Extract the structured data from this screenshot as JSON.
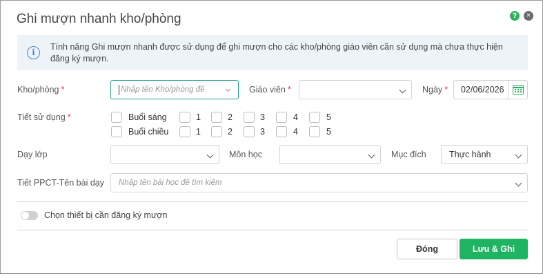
{
  "dialog": {
    "title": "Ghi mượn nhanh kho/phòng",
    "help_icon": "?",
    "close_icon": "×"
  },
  "info": {
    "icon": "i",
    "text": "Tính năng Ghi mượn nhanh được sử dụng để ghi mượn cho các kho/phòng giáo viên cần sử dụng mà chưa thực hiện đăng ký mượn."
  },
  "form": {
    "room": {
      "label": "Kho/phòng",
      "required": "*",
      "placeholder": "Nhập tên Kho/phòng để"
    },
    "teacher": {
      "label": "Giáo viên",
      "required": "*",
      "value": ""
    },
    "date": {
      "label": "Ngày",
      "required": "*",
      "value": "02/06/2026"
    },
    "periods": {
      "label": "Tiết sử dụng",
      "required": "*",
      "rows": [
        {
          "session": "Buổi sáng",
          "periods": [
            "1",
            "2",
            "3",
            "4",
            "5"
          ]
        },
        {
          "session": "Buổi chiều",
          "periods": [
            "1",
            "2",
            "3",
            "4",
            "5"
          ]
        }
      ]
    },
    "class": {
      "label": "Dạy lớp",
      "value": ""
    },
    "subject": {
      "label": "Môn học",
      "value": ""
    },
    "purpose": {
      "label": "Mục đích",
      "value": "Thực hành"
    },
    "lesson": {
      "label": "Tiết PPCT-Tên bài dạy",
      "placeholder": "Nhập tên bài học để tìm kiếm"
    }
  },
  "equipment_toggle": {
    "label": "Chọn thiết bị cần đăng ký mượn",
    "on": false
  },
  "buttons": {
    "close": "Đóng",
    "save": "Lưu & Ghi mượn"
  },
  "colors": {
    "accent": "#1fb461",
    "required": "#e53935",
    "info_bg": "#eef3f8",
    "focus": "#2a9d8f"
  }
}
